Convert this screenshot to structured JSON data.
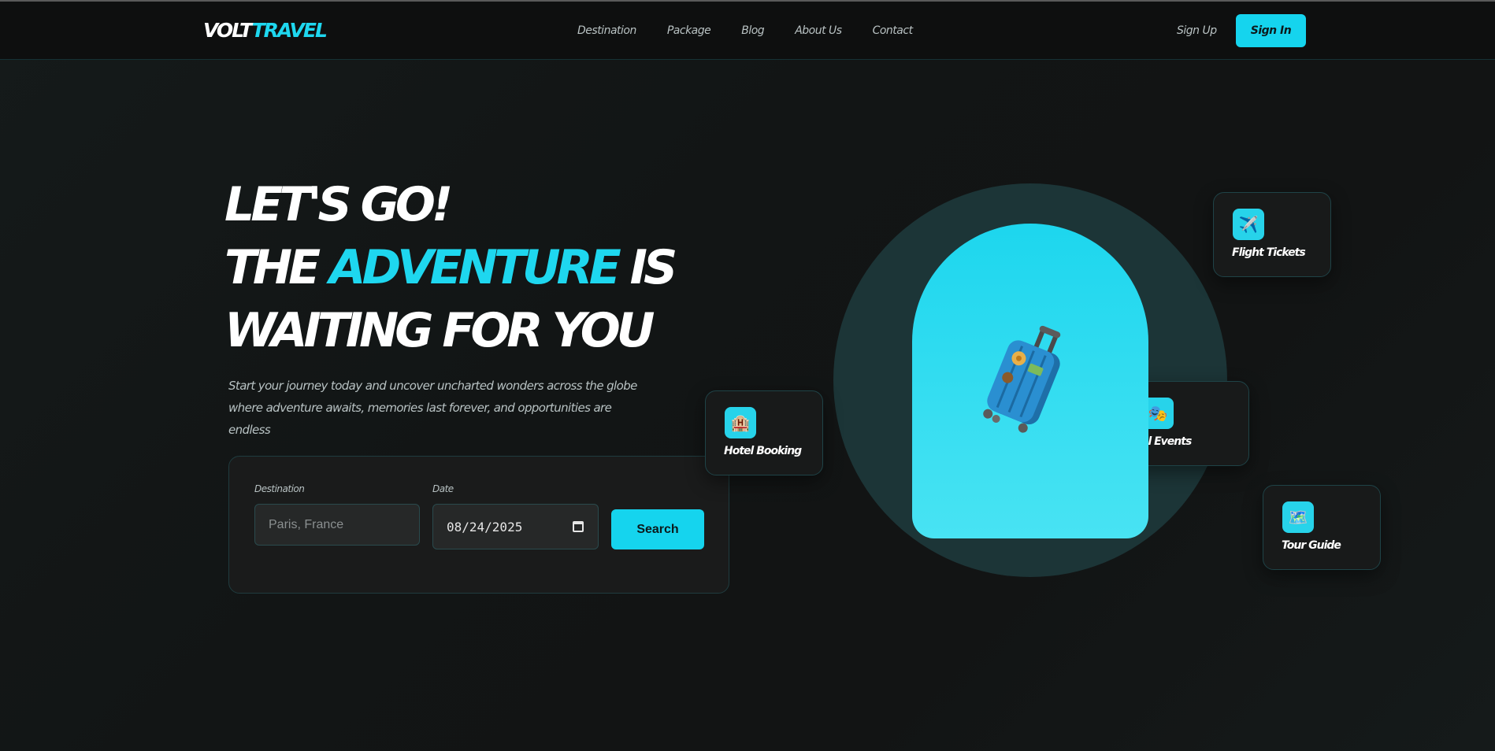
{
  "nav": {
    "logo_part1": "VOLT",
    "logo_part2": "TRAVEL",
    "links": [
      "Destination",
      "Package",
      "Blog",
      "About Us",
      "Contact"
    ],
    "sign_up": "Sign Up",
    "sign_in": "Sign In"
  },
  "hero": {
    "line1": "LET'S GO!",
    "line2_a": "THE ",
    "line2_accent": "ADVENTURE",
    "line2_b": " IS",
    "line3": "WAITING FOR YOU",
    "subtitle_1": "Start your journey today and uncover uncharted wonders across the globe",
    "subtitle_2": "where adventure awaits, memories last forever, and opportunities are endless"
  },
  "search": {
    "destination_label": "Destination",
    "destination_placeholder": "Paris, France",
    "date_label": "Date",
    "date_value": "08/24/2025",
    "button": "Search"
  },
  "cards": {
    "flight": {
      "label": "Flight Tickets",
      "icon": "airplane-icon",
      "glyph": "✈️"
    },
    "hotel": {
      "label": "Hotel Booking",
      "icon": "hotel-icon",
      "glyph": "🏨"
    },
    "events": {
      "label": "al Events",
      "icon": "events-icon",
      "glyph": "🎭"
    },
    "tour": {
      "label": "Tour Guide",
      "icon": "map-icon",
      "glyph": "🗺️"
    }
  },
  "illustration": {
    "glyph": "🧳",
    "icon": "suitcase-icon"
  },
  "colors": {
    "accent": "#15d4ee",
    "background": "#131616",
    "card": "#181a1a"
  }
}
